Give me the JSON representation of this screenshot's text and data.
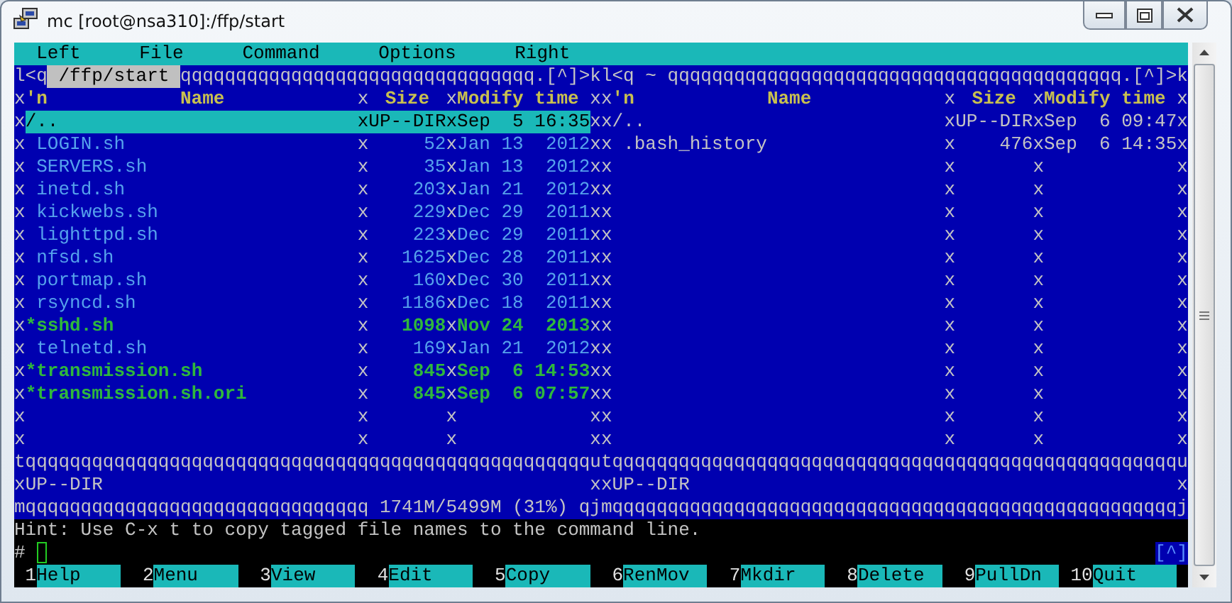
{
  "window": {
    "title": "mc [root@nsa310]:/ffp/start"
  },
  "menu_bar": [
    "Left",
    "File",
    "Command",
    "Options",
    "Right"
  ],
  "panels": [
    {
      "active": true,
      "lines": [
        {
          "kind": "top",
          "left": "l<q",
          "path": "/ffp/start",
          "fill": "qqqqqqqqqqqqqqqqqqqqqqqqqqqqqqqq",
          "right": ".[^]>k"
        },
        {
          "kind": "header",
          "frame": [
            "x",
            "x",
            "x",
            "x"
          ],
          "mark": "'n",
          "name": "Name",
          "size": "Size",
          "date": "Modify time"
        },
        {
          "kind": "dir",
          "selected": true,
          "frame": [
            "x",
            "x",
            "x",
            "x"
          ],
          "name": "/..",
          "size": "UP--DIR",
          "date": "Sep  5 16:35"
        },
        {
          "kind": "script",
          "selected": false,
          "frame": [
            "x",
            "x",
            "x",
            "x"
          ],
          "name": "LOGIN.sh",
          "size": "52",
          "date": "Jan 13  2012"
        },
        {
          "kind": "script",
          "selected": false,
          "frame": [
            "x",
            "x",
            "x",
            "x"
          ],
          "name": "SERVERS.sh",
          "size": "35",
          "date": "Jan 13  2012"
        },
        {
          "kind": "script",
          "selected": false,
          "frame": [
            "x",
            "x",
            "x",
            "x"
          ],
          "name": "inetd.sh",
          "size": "203",
          "date": "Jan 21  2012"
        },
        {
          "kind": "script",
          "selected": false,
          "frame": [
            "x",
            "x",
            "x",
            "x"
          ],
          "name": "kickwebs.sh",
          "size": "229",
          "date": "Dec 29  2011"
        },
        {
          "kind": "script",
          "selected": false,
          "frame": [
            "x",
            "x",
            "x",
            "x"
          ],
          "name": "lighttpd.sh",
          "size": "223",
          "date": "Dec 29  2011"
        },
        {
          "kind": "script",
          "selected": false,
          "frame": [
            "x",
            "x",
            "x",
            "x"
          ],
          "name": "nfsd.sh",
          "size": "1625",
          "date": "Dec 28  2011"
        },
        {
          "kind": "script",
          "selected": false,
          "frame": [
            "x",
            "x",
            "x",
            "x"
          ],
          "name": "portmap.sh",
          "size": "160",
          "date": "Dec 30  2011"
        },
        {
          "kind": "script",
          "selected": false,
          "frame": [
            "x",
            "x",
            "x",
            "x"
          ],
          "name": "rsyncd.sh",
          "size": "1186",
          "date": "Dec 18  2011"
        },
        {
          "kind": "exec",
          "selected": false,
          "frame": [
            "x",
            "x",
            "x",
            "x"
          ],
          "name": "*sshd.sh",
          "size": "1098",
          "date": "Nov 24  2013"
        },
        {
          "kind": "script",
          "selected": false,
          "frame": [
            "x",
            "x",
            "x",
            "x"
          ],
          "name": "telnetd.sh",
          "size": "169",
          "date": "Jan 21  2012"
        },
        {
          "kind": "exec",
          "selected": false,
          "frame": [
            "x",
            "x",
            "x",
            "x"
          ],
          "name": "*transmission.sh",
          "size": "845",
          "date": "Sep  6 14:53"
        },
        {
          "kind": "exec",
          "selected": false,
          "frame": [
            "x",
            "x",
            "x",
            "x"
          ],
          "name": "*transmission.sh.ori",
          "size": "845",
          "date": "Sep  6 07:57"
        },
        {
          "kind": "entry",
          "selected": false,
          "frame": [
            "x",
            "x",
            "x",
            "x"
          ]
        },
        {
          "kind": "entry",
          "selected": false,
          "frame": [
            "x",
            "x",
            "x",
            "x"
          ]
        },
        {
          "kind": "rule",
          "text": "tqqqqqqqqqqqqqqqqqqqqqqqqqqqqqqqqqqqqqqqqqqqqqqqqqqqu"
        },
        {
          "kind": "status",
          "frame": [
            "x",
            "x"
          ],
          "text": "UP--DIR"
        },
        {
          "kind": "bottom",
          "left": "mqqqqqqqqqqqqqqqqqqqqqqqqqqqqqqq",
          "info": "1741M/5499M (31%)",
          "right": "qj"
        }
      ]
    },
    {
      "active": false,
      "lines": [
        {
          "kind": "top",
          "left": "l<q",
          "path": "~",
          "fill": "qqqqqqqqqqqqqqqqqqqqqqqqqqqqqqqqqqqqqqqqq",
          "right": ".[^]>k"
        },
        {
          "kind": "header",
          "frame": [
            "x",
            "x",
            "x",
            "x"
          ],
          "mark": "'n",
          "name": "Name",
          "size": "Size",
          "date": "Modify time"
        },
        {
          "kind": "dir",
          "selected": false,
          "frame": [
            "x",
            "x",
            "x",
            "x"
          ],
          "name": "/..",
          "size": "UP--DIR",
          "date": "Sep  6 09:47"
        },
        {
          "kind": "file",
          "selected": false,
          "frame": [
            "x",
            "x",
            "x",
            "x"
          ],
          "name": ".bash_history",
          "size": "476",
          "date": "Sep  6 14:35"
        },
        {
          "kind": "entry",
          "selected": false,
          "frame": [
            "x",
            "x",
            "x",
            "x"
          ]
        },
        {
          "kind": "entry",
          "selected": false,
          "frame": [
            "x",
            "x",
            "x",
            "x"
          ]
        },
        {
          "kind": "entry",
          "selected": false,
          "frame": [
            "x",
            "x",
            "x",
            "x"
          ]
        },
        {
          "kind": "entry",
          "selected": false,
          "frame": [
            "x",
            "x",
            "x",
            "x"
          ]
        },
        {
          "kind": "entry",
          "selected": false,
          "frame": [
            "x",
            "x",
            "x",
            "x"
          ]
        },
        {
          "kind": "entry",
          "selected": false,
          "frame": [
            "x",
            "x",
            "x",
            "x"
          ]
        },
        {
          "kind": "entry",
          "selected": false,
          "frame": [
            "x",
            "x",
            "x",
            "x"
          ]
        },
        {
          "kind": "entry",
          "selected": false,
          "frame": [
            "x",
            "x",
            "x",
            "x"
          ]
        },
        {
          "kind": "entry",
          "selected": false,
          "frame": [
            "x",
            "x",
            "x",
            "x"
          ]
        },
        {
          "kind": "entry",
          "selected": false,
          "frame": [
            "x",
            "x",
            "x",
            "x"
          ]
        },
        {
          "kind": "entry",
          "selected": false,
          "frame": [
            "x",
            "x",
            "x",
            "x"
          ]
        },
        {
          "kind": "entry",
          "selected": false,
          "frame": [
            "x",
            "x",
            "x",
            "x"
          ]
        },
        {
          "kind": "entry",
          "selected": false,
          "frame": [
            "x",
            "x",
            "x",
            "x"
          ]
        },
        {
          "kind": "rule",
          "text": "tqqqqqqqqqqqqqqqqqqqqqqqqqqqqqqqqqqqqqqqqqqqqqqqqqqqu"
        },
        {
          "kind": "status",
          "frame": [
            "x",
            "x"
          ],
          "text": "UP--DIR"
        },
        {
          "kind": "bottom",
          "left": "mqqqqqqqqqqqqqqqqqqqqqqqqqqqqqqqqqqqqqqqqqqqqqqqqqqqj"
        }
      ]
    }
  ],
  "hint": "Hint: Use C-x t to copy tagged file names to the command line.",
  "prompt": {
    "symbol": "#",
    "history": "[^]"
  },
  "keys": [
    {
      "number": "1",
      "label": "Help"
    },
    {
      "number": "2",
      "label": "Menu"
    },
    {
      "number": "3",
      "label": "View"
    },
    {
      "number": "4",
      "label": "Edit"
    },
    {
      "number": "5",
      "label": "Copy"
    },
    {
      "number": "6",
      "label": "RenMov"
    },
    {
      "number": "7",
      "label": "Mkdir"
    },
    {
      "number": "8",
      "label": "Delete"
    },
    {
      "number": "9",
      "label": "PullDn"
    },
    {
      "number": "10",
      "label": "Quit"
    }
  ]
}
